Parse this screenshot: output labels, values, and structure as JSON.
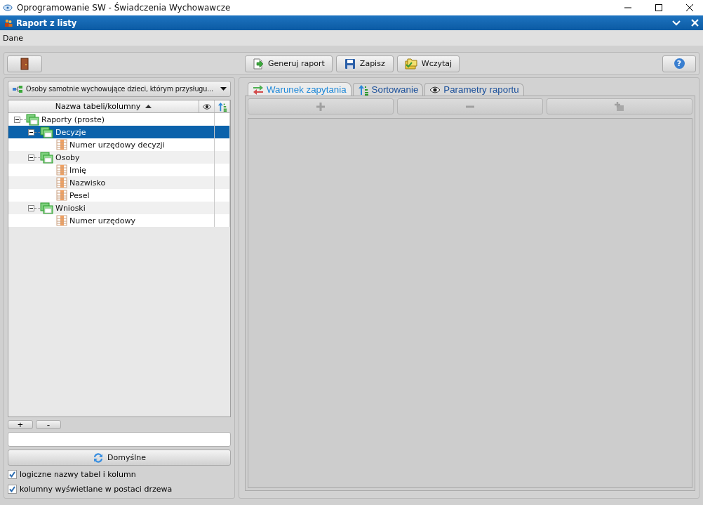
{
  "app_window": {
    "title": "Oprogramowanie SW - Świadczenia Wychowawcze"
  },
  "dialog": {
    "title": "Raport z listy"
  },
  "menu": [
    "Dane"
  ],
  "toolbar": {
    "buttons": [
      {
        "kind": "exit"
      },
      {
        "kind": "generate",
        "label": "Generuj raport"
      },
      {
        "kind": "save",
        "label": "Zapisz"
      },
      {
        "kind": "load",
        "label": "Wczytaj"
      },
      {
        "kind": "help",
        "label": "?"
      }
    ]
  },
  "left_panel": {
    "report_selector": {
      "value": "Osoby samotnie wychowujące dzieci, którym przysługu..."
    },
    "tree": {
      "column": "Nazwa tabeli/kolumny",
      "sorted_ascending": true,
      "items": [
        {
          "label": "Raporty (proste)",
          "kind": "group",
          "expanded": true,
          "selected": false,
          "children": [
            {
              "label": "Decyzje",
              "kind": "table",
              "expanded": true,
              "selected": true,
              "children": [
                {
                  "label": "Numer urzędowy decyzji",
                  "kind": "column",
                  "selected": false
                }
              ]
            },
            {
              "label": "Osoby",
              "kind": "table",
              "expanded": true,
              "selected": false,
              "children": [
                {
                  "label": "Imię",
                  "kind": "column",
                  "selected": false
                },
                {
                  "label": "Nazwisko",
                  "kind": "column",
                  "selected": false
                },
                {
                  "label": "Pesel",
                  "kind": "column",
                  "selected": false
                }
              ]
            },
            {
              "label": "Wnioski",
              "kind": "table",
              "expanded": true,
              "selected": false,
              "children": [
                {
                  "label": "Numer urzędowy",
                  "kind": "column",
                  "selected": false
                }
              ]
            }
          ]
        }
      ]
    },
    "small_buttons": [
      "+",
      "-"
    ],
    "defaults_button": "Domyślne",
    "checkboxes": [
      {
        "label": "logiczne nazwy tabel i kolumn",
        "checked": true
      },
      {
        "label": "kolumny wyświetlane w postaci drzewa",
        "checked": true
      }
    ]
  },
  "right_panel": {
    "tabs": [
      {
        "label": "Warunek zapytania",
        "kind": "condition",
        "selected": true
      },
      {
        "label": "Sortowanie",
        "kind": "sort",
        "selected": false
      },
      {
        "label": "Parametry raportu",
        "kind": "params",
        "selected": false
      }
    ],
    "condition_buttons": [
      {
        "kind": "add",
        "disabled": true
      },
      {
        "kind": "remove",
        "disabled": true
      },
      {
        "kind": "add-group",
        "disabled": true
      }
    ]
  }
}
